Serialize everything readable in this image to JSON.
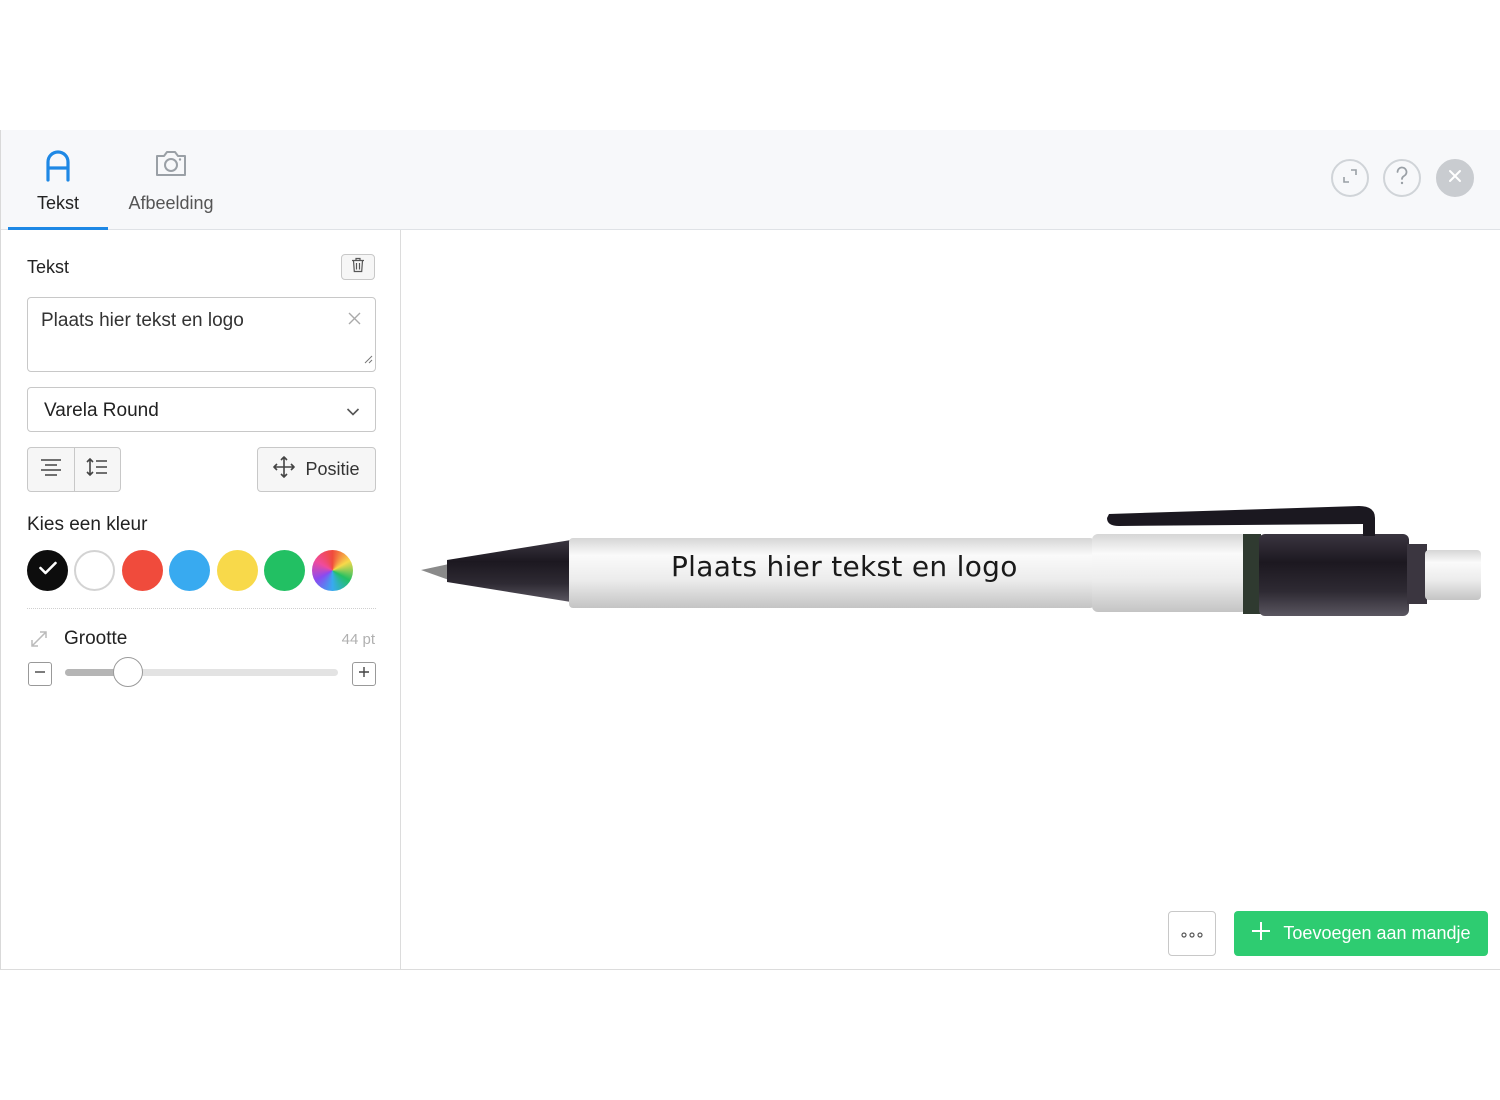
{
  "tabs": [
    {
      "label": "Tekst",
      "icon": "letter-a-icon",
      "active": true
    },
    {
      "label": "Afbeelding",
      "icon": "camera-icon",
      "active": false
    }
  ],
  "header_actions": {
    "expand_icon": "expand-icon",
    "help_icon": "help-icon",
    "close_icon": "close-icon"
  },
  "sidebar": {
    "section_title": "Tekst",
    "text_input": {
      "value": "Plaats hier tekst en logo"
    },
    "font_select": {
      "selected": "Varela Round"
    },
    "align_buttons": [
      "align-center-icon",
      "line-spacing-icon"
    ],
    "position_button": "Positie",
    "color_label": "Kies een kleur",
    "colors": [
      {
        "name": "black",
        "hex": "#0d0d0d",
        "selected": true
      },
      {
        "name": "white",
        "hex": "#ffffff",
        "selected": false
      },
      {
        "name": "red",
        "hex": "#f04b3c",
        "selected": false
      },
      {
        "name": "blue",
        "hex": "#38aaf0",
        "selected": false
      },
      {
        "name": "yellow",
        "hex": "#f8d94a",
        "selected": false
      },
      {
        "name": "green",
        "hex": "#22c063",
        "selected": false
      },
      {
        "name": "custom",
        "hex": "rainbow",
        "selected": false
      }
    ],
    "size": {
      "label": "Grootte",
      "value": "44 pt",
      "slider_fraction": 0.23
    }
  },
  "canvas": {
    "product": "pen",
    "preview_text": "Plaats hier tekst en logo"
  },
  "footer": {
    "more_icon": "more-icon",
    "add_to_cart": "Toevoegen aan mandje"
  },
  "accent": {
    "blue": "#1e88e5",
    "green": "#2ecc71"
  }
}
